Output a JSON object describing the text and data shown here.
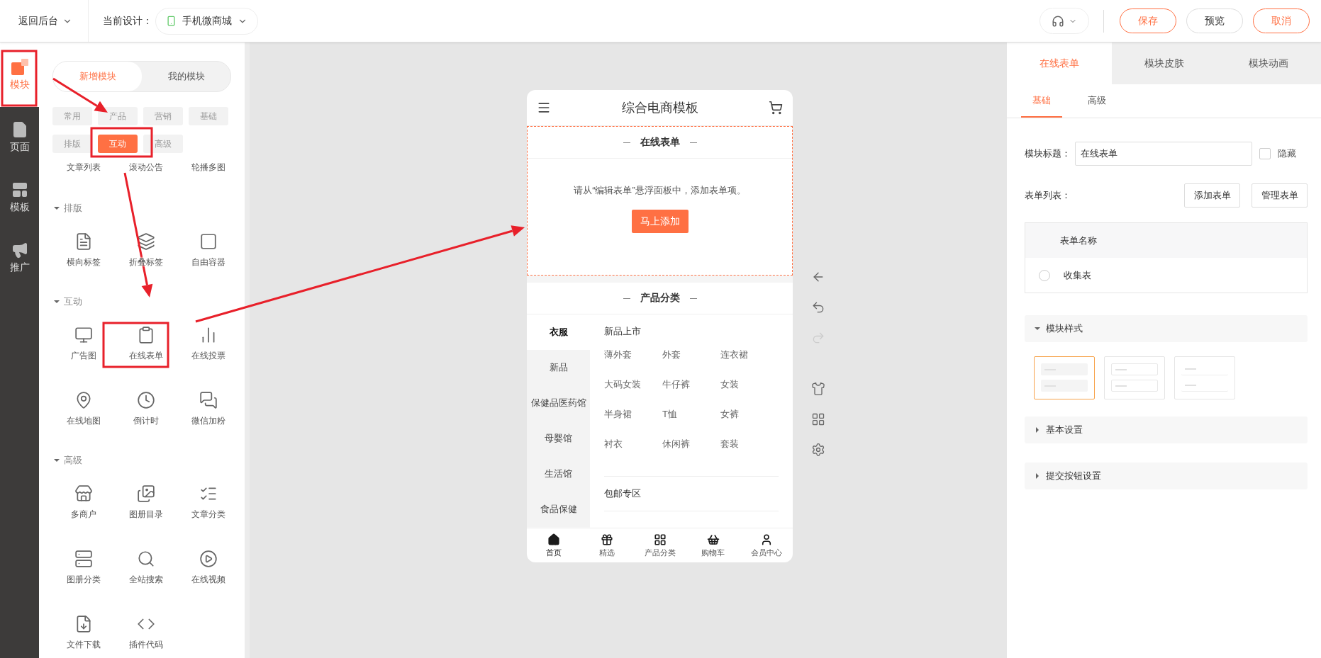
{
  "top_bar": {
    "back": "返回后台",
    "design_label": "当前设计：",
    "design_value": "手机微商城",
    "buttons": [
      {
        "label": "保存",
        "kind": "accent"
      },
      {
        "label": "预览",
        "kind": "plain"
      },
      {
        "label": "取消",
        "kind": "accent"
      }
    ]
  },
  "rail": [
    {
      "label": "模块",
      "selected": true
    },
    {
      "label": "页面",
      "selected": false
    },
    {
      "label": "模板",
      "selected": false
    },
    {
      "label": "推广",
      "selected": false
    }
  ],
  "module_panel": {
    "tabs": [
      {
        "label": "新增模块",
        "selected": true
      },
      {
        "label": "我的模块",
        "selected": false
      }
    ],
    "categories": [
      {
        "label": "常用",
        "selected": false
      },
      {
        "label": "产品",
        "selected": false
      },
      {
        "label": "营销",
        "selected": false
      },
      {
        "label": "基础",
        "selected": false
      },
      {
        "label": "排版",
        "selected": false
      },
      {
        "label": "互动",
        "selected": true
      },
      {
        "label": "高级",
        "selected": false
      }
    ],
    "partial_items": [
      "文章列表",
      "滚动公告",
      "轮播多图"
    ],
    "sections": [
      {
        "title": "排版",
        "expanded": true,
        "items": [
          "横向标签",
          "折叠标签",
          "自由容器"
        ]
      },
      {
        "title": "互动",
        "expanded": true,
        "items": [
          "广告图",
          "在线表单",
          "在线投票",
          "在线地图",
          "倒计时",
          "微信加粉"
        ]
      },
      {
        "title": "高级",
        "expanded": true,
        "items": [
          "多商户",
          "图册目录",
          "文章分类",
          "图册分类",
          "全站搜索",
          "在线视频",
          "文件下载",
          "插件代码"
        ]
      }
    ]
  },
  "phone": {
    "title": "综合电商模板",
    "form_module": {
      "title": "在线表单",
      "message": "请从“编辑表单”悬浮面板中，添加表单项。",
      "button": "马上添加"
    },
    "category_module": {
      "title": "产品分类",
      "categories": [
        {
          "label": "衣服",
          "selected": true
        },
        {
          "label": "新品",
          "selected": false
        },
        {
          "label": "保健品医药馆",
          "selected": false
        },
        {
          "label": "母婴馆",
          "selected": false
        },
        {
          "label": "生活馆",
          "selected": false
        },
        {
          "label": "食品保健",
          "selected": false
        }
      ],
      "groups": [
        {
          "title": "新品上市",
          "items": [
            "薄外套",
            "外套",
            "连衣裙",
            "大码女装",
            "牛仔裤",
            "女装",
            "半身裙",
            "T恤",
            "女裤",
            "衬衣",
            "休闲裤",
            "套装"
          ]
        },
        {
          "title": "包邮专区"
        }
      ]
    },
    "nav": [
      {
        "label": "首页",
        "selected": true
      },
      {
        "label": "精选",
        "selected": false
      },
      {
        "label": "产品分类",
        "selected": false
      },
      {
        "label": "购物车",
        "selected": false
      },
      {
        "label": "会员中心",
        "selected": false
      }
    ]
  },
  "tools": [
    {
      "disabled": false
    },
    {
      "disabled": false
    },
    {
      "disabled": true
    },
    {
      "disabled": false
    },
    {
      "disabled": false
    },
    {
      "disabled": false
    }
  ],
  "right_panel": {
    "tabs": [
      {
        "label": "在线表单",
        "selected": true
      },
      {
        "label": "模块皮肤",
        "selected": false
      },
      {
        "label": "模块动画",
        "selected": false
      }
    ],
    "subtabs": [
      {
        "label": "基础",
        "selected": true
      },
      {
        "label": "高级",
        "selected": false
      }
    ],
    "title_field": {
      "label": "模块标题：",
      "value": "在线表单",
      "hide_label": "隐藏",
      "hidden": false
    },
    "form_list": {
      "label": "表单列表：",
      "buttons": [
        "添加表单",
        "管理表单"
      ],
      "column": "表单名称",
      "rows": [
        {
          "name": "收集表",
          "selected": false
        }
      ]
    },
    "style_section": {
      "title": "模块样式",
      "expanded": true,
      "styles": [
        {
          "selected": true
        },
        {
          "selected": false
        },
        {
          "selected": false
        }
      ]
    },
    "sections": [
      {
        "title": "基本设置",
        "expanded": false
      },
      {
        "title": "提交按钮设置",
        "expanded": false
      }
    ]
  }
}
